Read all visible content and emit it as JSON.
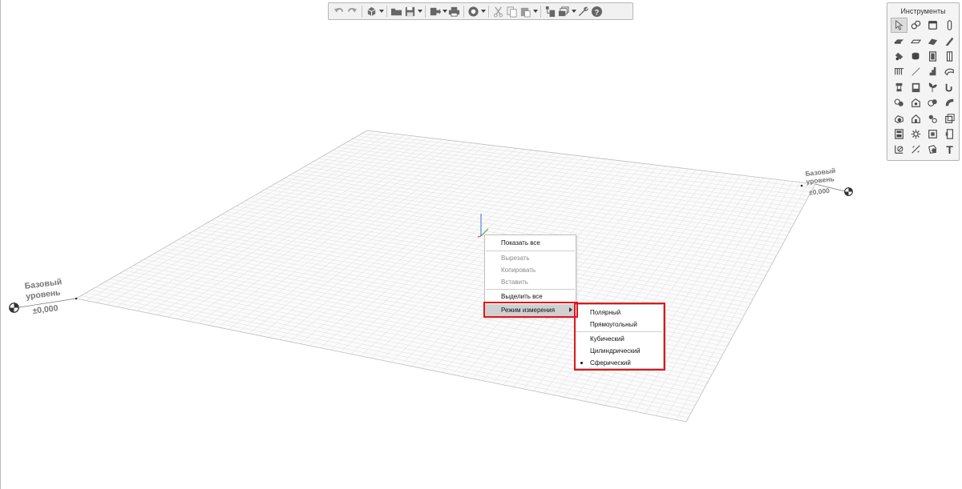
{
  "toolbar": {
    "buttons": [
      "undo-icon",
      "redo-icon",
      "3d-view-icon",
      "open-folder-icon",
      "save-icon",
      "export-icon",
      "print-icon",
      "render-icon",
      "cut-icon",
      "copy-icon",
      "paste-icon",
      "plan-icon",
      "layers-icon",
      "wrench-icon",
      "help-icon"
    ]
  },
  "tools": {
    "title": "Инструменты",
    "icons": [
      "select-arrow-icon",
      "camera-icon",
      "wall-icon",
      "column-icon",
      "slab-icon",
      "beam-icon",
      "roof-icon",
      "pencil-icon",
      "mesh-icon",
      "cylinder-icon",
      "door-icon",
      "window-icon",
      "railing-icon",
      "line-icon",
      "stair-icon",
      "duct-icon",
      "fixture-icon",
      "cabinet-icon",
      "plant-icon",
      "pipe-icon",
      "texture-icon",
      "object-icon",
      "materials-icon",
      "shape-icon",
      "furniture-icon",
      "house-icon",
      "light-icon",
      "box-icon",
      "building-icon",
      "gear-icon",
      "room-icon",
      "zone-icon",
      "section-icon",
      "cut-plane-icon",
      "label-icon",
      "text-icon"
    ],
    "text_glyph": "T"
  },
  "levels": {
    "right": {
      "name_line1": "Базовый",
      "name_line2": "уровень",
      "value": "±0,000"
    },
    "left": {
      "name_line1": "Базовый",
      "name_line2": "уровень",
      "value": "±0,000"
    }
  },
  "context_menu": {
    "items": [
      {
        "label": "Показать все",
        "disabled": false
      },
      {
        "label": "Вырезать",
        "disabled": true
      },
      {
        "label": "Копировать",
        "disabled": true
      },
      {
        "label": "Вставить",
        "disabled": true
      },
      {
        "label": "Выделить все",
        "disabled": false
      },
      {
        "label": "Режим измерения",
        "disabled": false,
        "highlighted": true,
        "has_submenu": true
      }
    ]
  },
  "submenu": {
    "items": [
      {
        "label": "Полярный",
        "checked": false
      },
      {
        "label": "Прямоугольный",
        "checked": false
      },
      {
        "label": "Кубический",
        "checked": false
      },
      {
        "label": "Цилиндрический",
        "checked": false
      },
      {
        "label": "Сферический",
        "checked": true
      }
    ]
  },
  "colors": {
    "grid_line": "#dcdcdc",
    "grid_edge": "#bfbfbf",
    "highlight_border": "#e0161c",
    "menu_highlight": "#d0d0d0",
    "axis_z": "#3b6fd0",
    "axis_y": "#3aa83a"
  }
}
